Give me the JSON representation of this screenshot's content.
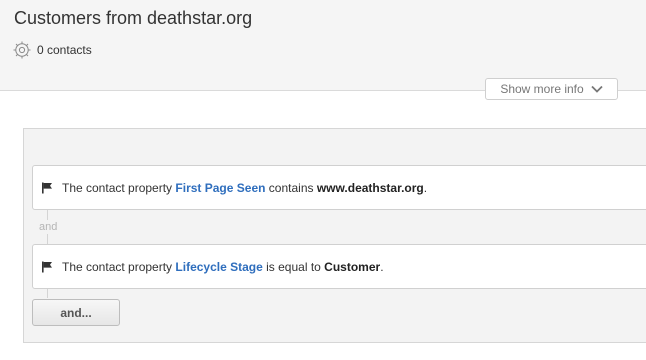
{
  "header": {
    "title": "Customers from deathstar.org",
    "contacts_count": "0 contacts",
    "contacts_icon": "gear-icon",
    "show_more_label": "Show more info",
    "show_more_icon": "chevron-down-icon"
  },
  "filters": [
    {
      "icon": "flag-icon",
      "prefix": "The contact property",
      "property": "First Page Seen",
      "operator": "contains",
      "value": "www.deathstar.org",
      "suffix": "."
    },
    {
      "icon": "flag-icon",
      "prefix": "The contact property",
      "property": "Lifecycle Stage",
      "operator": "is equal to",
      "value": "Customer",
      "suffix": "."
    }
  ],
  "connector_label": "and",
  "add_filter_label": "and...",
  "colors": {
    "link": "#2f6ebd",
    "header_bg": "#f5f5f5",
    "panel_bg": "#f3f3f3"
  }
}
